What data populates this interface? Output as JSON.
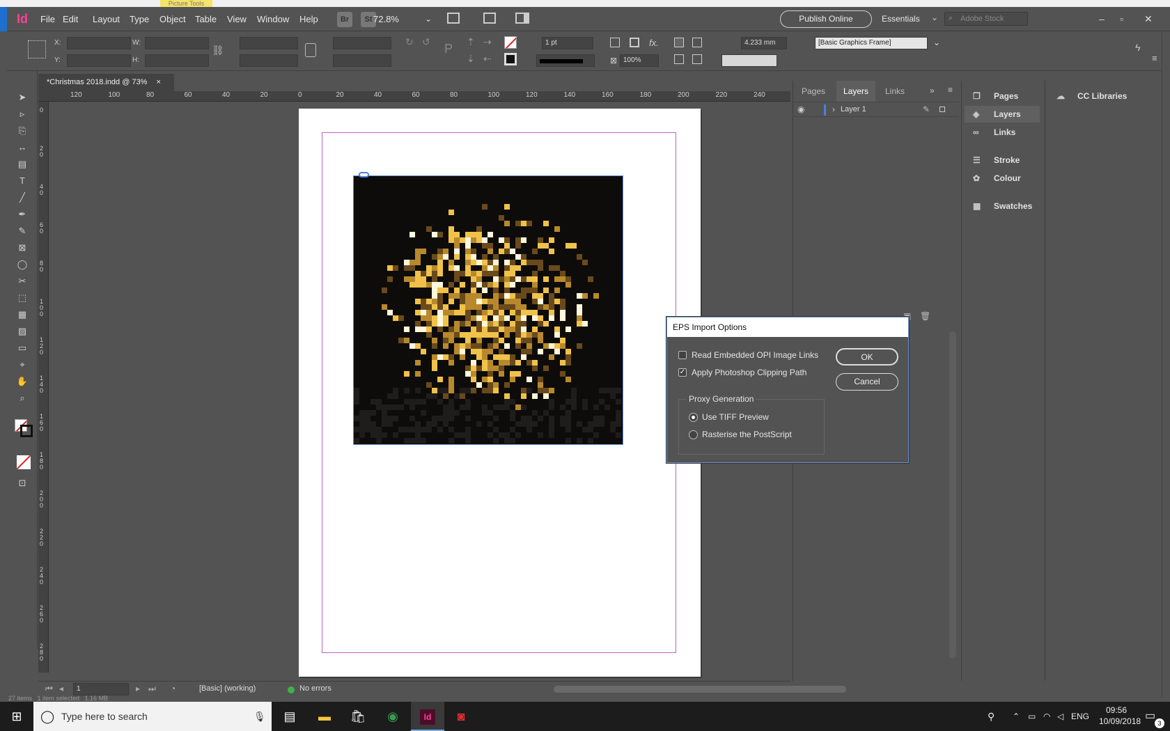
{
  "app": {
    "logo": "Id",
    "picture_tools": "Picture Tools"
  },
  "menu": [
    "File",
    "Edit",
    "Layout",
    "Type",
    "Object",
    "Table",
    "View",
    "Window",
    "Help"
  ],
  "menubar": {
    "bridge": "Br",
    "stock": "St",
    "zoom": "72.8%",
    "publish": "Publish Online",
    "workspace": "Essentials",
    "search_placeholder": "Adobe Stock"
  },
  "control": {
    "x_label": "X:",
    "y_label": "Y:",
    "w_label": "W:",
    "h_label": "H:",
    "stroke_weight": "1 pt",
    "scale": "100%",
    "offset": "4.233 mm",
    "object_style": "[Basic Graphics Frame]"
  },
  "document": {
    "tab": "*Christmas 2018.indd @ 73%",
    "close": "×"
  },
  "ruler": {
    "h": [
      "120",
      "100",
      "80",
      "60",
      "40",
      "20",
      "0",
      "20",
      "40",
      "60",
      "80",
      "100",
      "120",
      "140",
      "160",
      "180",
      "200",
      "220",
      "240"
    ],
    "v": [
      "0",
      "20",
      "40",
      "60",
      "80",
      "100",
      "120",
      "140",
      "160",
      "180",
      "200",
      "220",
      "240",
      "260",
      "280"
    ]
  },
  "status": {
    "page": "1",
    "profile": "[Basic] (working)",
    "errors": "No errors",
    "below": "27 items   1 item selected   1.16 MB"
  },
  "layers_panel": {
    "tabs": [
      "Pages",
      "Layers",
      "Links"
    ],
    "active": "Layers",
    "layer": "Layer 1"
  },
  "dock": {
    "items": [
      "Pages",
      "Layers",
      "Links",
      "Stroke",
      "Colour",
      "Swatches"
    ],
    "libraries": "CC Libraries"
  },
  "dialog": {
    "title": "EPS Import Options",
    "read_opi": {
      "label": "Read Embedded OPI Image Links",
      "checked": false
    },
    "clipping": {
      "label": "Apply Photoshop Clipping Path",
      "checked": true
    },
    "proxy_group": "Proxy Generation",
    "tiff": {
      "label": "Use TIFF Preview",
      "selected": true
    },
    "raster": {
      "label": "Rasterise the PostScript",
      "selected": false
    },
    "ok": "OK",
    "cancel": "Cancel"
  },
  "taskbar": {
    "search": "Type here to search",
    "lang": "ENG",
    "time": "09:56",
    "date": "10/09/2018",
    "notifications": "3"
  },
  "colors": {
    "accent": "#ff3f94",
    "margin": "#c060c0",
    "selection": "#5a8ce0",
    "gold": "#d9a93a"
  }
}
